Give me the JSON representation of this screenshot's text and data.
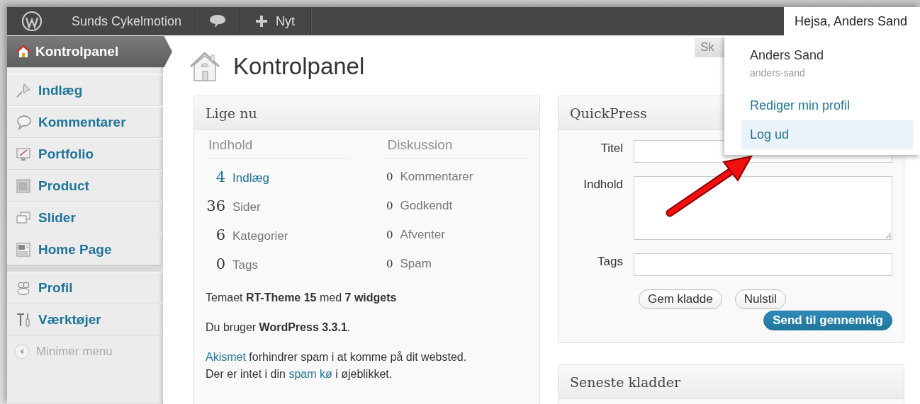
{
  "admin_bar": {
    "site_name": "Sunds Cykelmotion",
    "new_label": "Nyt",
    "greeting": "Hejsa, Anders Sand"
  },
  "sidebar": {
    "groups": [
      {
        "items": [
          {
            "label": "Kontrolpanel",
            "kind": "home",
            "selected": true
          },
          {
            "label": "Indlæg",
            "kind": "pin",
            "selected": false
          },
          {
            "label": "Kommentarer",
            "kind": "bubble",
            "selected": false
          },
          {
            "label": "Portfolio",
            "kind": "monitor",
            "selected": false
          },
          {
            "label": "Product",
            "kind": "grid",
            "selected": false
          },
          {
            "label": "Slider",
            "kind": "slides",
            "selected": false
          },
          {
            "label": "Home Page",
            "kind": "layout",
            "selected": false
          }
        ]
      },
      {
        "items": [
          {
            "label": "Profil",
            "kind": "users",
            "selected": false
          },
          {
            "label": "Værktøjer",
            "kind": "tools",
            "selected": false
          }
        ]
      }
    ],
    "collapse_label": "Minimer menu"
  },
  "page": {
    "title": "Kontrolpanel",
    "screen_options": "Sk"
  },
  "right_now": {
    "title": "Lige nu",
    "content_heading": "Indhold",
    "discussion_heading": "Diskussion",
    "content_rows": [
      {
        "count": "4",
        "label": "Indlæg",
        "linked": true
      },
      {
        "count": "36",
        "label": "Sider",
        "linked": false
      },
      {
        "count": "6",
        "label": "Kategorier",
        "linked": false
      },
      {
        "count": "0",
        "label": "Tags",
        "linked": false
      }
    ],
    "discussion_rows": [
      {
        "count": "0",
        "label": "Kommentarer",
        "linked": false
      },
      {
        "count": "0",
        "label": "Godkendt",
        "linked": false
      },
      {
        "count": "0",
        "label": "Afventer",
        "linked": false
      },
      {
        "count": "0",
        "label": "Spam",
        "linked": false
      }
    ],
    "theme_line": "Temaet **RT-Theme 15** med **7 widgets**",
    "version_line": "Du bruger **WordPress 3.3.1**.",
    "akismet_lines": [
      [
        {
          "text": "Akismet",
          "link": true
        },
        {
          "text": " forhindrer spam i at komme på dit websted.",
          "link": false
        }
      ],
      [
        {
          "text": "Der er intet i din ",
          "link": false
        },
        {
          "text": "spam kø",
          "link": true
        },
        {
          "text": " i øjeblikket.",
          "link": false
        }
      ]
    ]
  },
  "quickpress": {
    "title": "QuickPress",
    "fields": [
      {
        "label": "Titel",
        "kind": "input"
      },
      {
        "label": "Indhold",
        "kind": "textarea"
      },
      {
        "label": "Tags",
        "kind": "input"
      }
    ],
    "buttons": [
      "Gem kladde",
      "Nulstil"
    ],
    "submit": "Send til gennemkig"
  },
  "drafts": {
    "title": "Seneste kladder"
  },
  "user_menu": {
    "name": "Anders Sand",
    "username": "anders-sand",
    "items": [
      {
        "label": "Rediger min profil",
        "selected": false
      },
      {
        "label": "Log ud",
        "selected": true
      }
    ]
  }
}
